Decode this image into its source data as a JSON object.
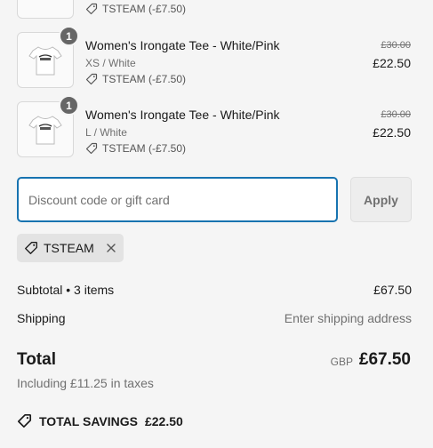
{
  "line_items": [
    {
      "discount_label": "TSTEAM (-£7.50)"
    },
    {
      "quantity": "1",
      "title": "Women's Irongate Tee - White/Pink",
      "variant": "XS / White",
      "discount_label": "TSTEAM (-£7.50)",
      "original_price": "£30.00",
      "price": "£22.50"
    },
    {
      "quantity": "1",
      "title": "Women's Irongate Tee - White/Pink",
      "variant": "L / White",
      "discount_label": "TSTEAM (-£7.50)",
      "original_price": "£30.00",
      "price": "£22.50"
    }
  ],
  "discount_form": {
    "placeholder": "Discount code or gift card",
    "value": "",
    "apply_label": "Apply"
  },
  "applied_code": {
    "code": "TSTEAM"
  },
  "summary": {
    "subtotal_label": "Subtotal • 3 items",
    "subtotal_value": "£67.50",
    "shipping_label": "Shipping",
    "shipping_value": "Enter shipping address",
    "total_label": "Total",
    "currency": "GBP",
    "total_value": "£67.50",
    "taxes_note": "Including £11.25 in taxes",
    "savings_label": "TOTAL SAVINGS",
    "savings_value": "£22.50"
  },
  "icons": {
    "tag": "tag-icon",
    "close": "close-icon",
    "product": "tshirt-icon"
  },
  "colors": {
    "focus_border": "#1773b0",
    "background": "#f5f5f5",
    "badge": "#666666"
  }
}
